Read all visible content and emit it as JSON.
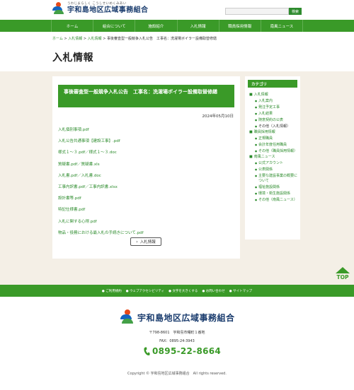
{
  "header": {
    "logo_sub": "うわじまらしく こうしせいめくみあい",
    "logo_main": "宇和島地区広域事務組合",
    "search_placeholder": "",
    "search_button": "検索"
  },
  "nav": [
    "ホーム",
    "組合について",
    "施設紹介",
    "入札情報",
    "職員採用情報",
    "南風ニュース"
  ],
  "breadcrumb": {
    "items": [
      "ホーム",
      "入札情報",
      "入札情報"
    ],
    "sep": " > ",
    "current": "事後審査型一般競争入札公告　工事名：洗濯場ボイラー設備取替修繕"
  },
  "page_title": "入札情報",
  "article": {
    "title": "事後審査型一般競争入札公告　工事名：洗濯場ボイラー設備取替修繕",
    "date": "2024年05月10日",
    "files": [
      "入札個別事項.pdf",
      "入札公告共通事項【建設工事】.pdf",
      "様式１～３.pdf／様式１～３.doc",
      "質疑書.pdf／質疑書.xls",
      "入札書.pdf／入札書.doc",
      "工事内訳書.pdf／工事内訳書.xlsx",
      "設計書等.pdf",
      "特記仕様書.pdf",
      "入札に関する心得.pdf",
      "物品・役務における最入札の手続きについて.pdf"
    ],
    "back_button": "入札情報"
  },
  "sidebar": {
    "heading": "カテゴリ",
    "categories": [
      {
        "label": "入札情報",
        "items": [
          "入札案内",
          "発注予定工事",
          "入札結果",
          "随意契約の公表",
          "その他（入札情報）"
        ],
        "plain_index": 4
      },
      {
        "label": "職員採用情報",
        "items": [
          "正規職員",
          "会計年度任用職員",
          "その他（職員採用情報）"
        ]
      },
      {
        "label": "南風ニュース",
        "items": [
          "公式アカウント",
          "公表関係",
          "主要な建設事業の概要について",
          "福祉施設関係",
          "環境・衛生施設関係",
          "その他（南風ニュース）"
        ]
      }
    ]
  },
  "top_button": "TOP",
  "footer": {
    "links": [
      "ご利用規約",
      "ウェブアクセシビリティ",
      "文字を大きくする",
      "お問い合わせ",
      "サイトマップ"
    ],
    "name": "宇和島地区広域事務組合",
    "address": "〒798-8601　宇和島市曙町１番地",
    "fax": "FAX：0895-24-3943",
    "tel": "0895-22-8664",
    "copyright": "Copyright © 宇和島地区広域事務組合　All rights reserved."
  },
  "colors": {
    "brand_green": "#3a9a28",
    "brand_navy": "#1a3c6e",
    "bg_beige": "#f4efe6"
  }
}
